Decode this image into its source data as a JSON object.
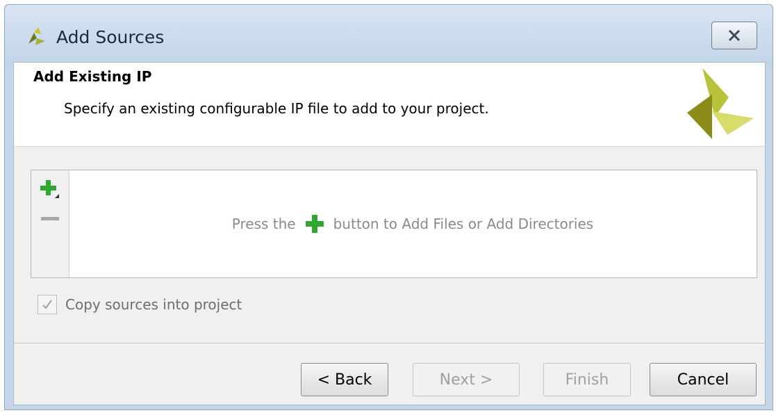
{
  "window": {
    "title": "Add Sources"
  },
  "header": {
    "title": "Add Existing IP",
    "description": "Specify an existing configurable IP file to add to your project."
  },
  "file_panel": {
    "message_before": "Press the",
    "message_after": "button to Add Files or Add Directories",
    "add_icon": "plus-icon",
    "remove_icon": "minus-icon"
  },
  "options": {
    "copy_sources_label": "Copy sources into project",
    "copy_sources_checked": true,
    "copy_sources_enabled": false
  },
  "buttons": {
    "back": "< Back",
    "next": "Next >",
    "finish": "Finish",
    "cancel": "Cancel"
  },
  "colors": {
    "plus_green": "#2ea82e",
    "logo_dark": "#8b8b1a",
    "logo_light": "#d8dc6a"
  }
}
